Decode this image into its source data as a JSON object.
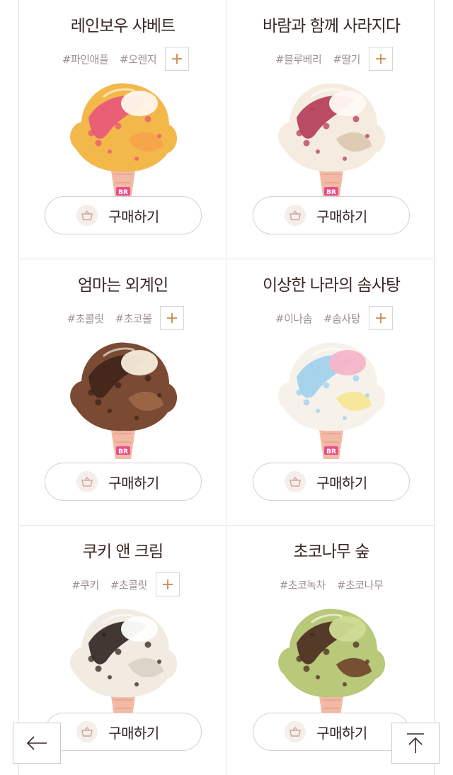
{
  "products": [
    {
      "name": "레인보우 샤베트",
      "tags": [
        "#파인애플",
        "#오렌지"
      ],
      "buy_label": "구매하기",
      "scoop": "rainbow-sherbet",
      "colors": {
        "base": "#f3b84a",
        "a": "#e8557a",
        "b": "#fff7ec",
        "c": "#f6a14a"
      }
    },
    {
      "name": "바람과 함께 사라지다",
      "tags": [
        "#블루베리",
        "#딸기"
      ],
      "buy_label": "구매하기",
      "scoop": "gone-with-the-wind",
      "colors": {
        "base": "#f5ecdf",
        "a": "#b33b57",
        "b": "#fffaf3",
        "c": "#d9c6ad"
      }
    },
    {
      "name": "엄마는 외계인",
      "tags": [
        "#초콜릿",
        "#초코볼"
      ],
      "buy_label": "구매하기",
      "scoop": "mom-is-an-alien",
      "colors": {
        "base": "#7a4a33",
        "a": "#3f2418",
        "b": "#f7ecdc",
        "c": "#a06a48"
      }
    },
    {
      "name": "이상한 나라의 솜사탕",
      "tags": [
        "#이나솜",
        "#솜사탕"
      ],
      "buy_label": "구매하기",
      "scoop": "cotton-candy-wonderland",
      "colors": {
        "base": "#f6f2ea",
        "a": "#9fd0ec",
        "b": "#f6b5c9",
        "c": "#f7e58c"
      }
    },
    {
      "name": "쿠키 앤 크림",
      "tags": [
        "#쿠키",
        "#초콜릿"
      ],
      "buy_label": "구매하기",
      "scoop": "cookies-and-cream",
      "colors": {
        "base": "#f1ebe2",
        "a": "#2f2420",
        "b": "#ffffff",
        "c": "#d8cfc4"
      }
    },
    {
      "name": "초코나무 숲",
      "tags": [
        "#초코녹차",
        "#초코나무"
      ],
      "buy_label": "구매하기",
      "scoop": "choco-forest",
      "colors": {
        "base": "#b8c97a",
        "a": "#4a2a1f",
        "b": "#cfdc93",
        "c": "#6b3a26"
      }
    }
  ],
  "show_plus": [
    true,
    true,
    true,
    true,
    true,
    false
  ],
  "nav": {
    "back_icon": "arrow-left-icon",
    "top_icon": "arrow-up-icon"
  },
  "theme": {
    "accent": "#c98a4b",
    "text": "#3b2a26",
    "tag": "#9d9190"
  }
}
